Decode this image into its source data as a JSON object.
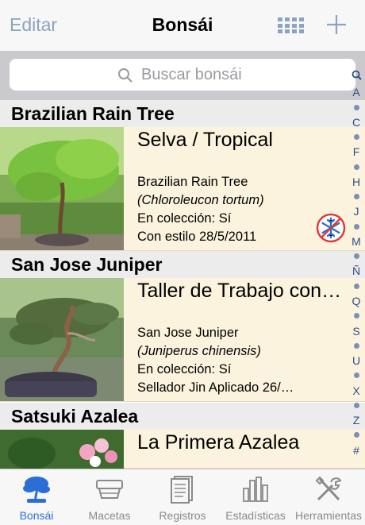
{
  "nav": {
    "edit": "Editar",
    "title": "Bonsái"
  },
  "search": {
    "placeholder": "Buscar bonsái"
  },
  "sections": [
    {
      "header": "Brazilian Rain Tree",
      "item": {
        "title": "Selva / Tropical",
        "common_name": "Brazilian Rain Tree",
        "scientific_name": "(Chloroleucon tortum)",
        "collection": "En colección: Sí",
        "status": "Con estilo 28/5/2011",
        "badge_icon": "no-frost-icon"
      }
    },
    {
      "header": "San Jose Juniper",
      "item": {
        "title": "Taller de Trabajo con…",
        "common_name": "San Jose Juniper",
        "scientific_name": "(Juniperus chinensis)",
        "collection": "En colección: Sí",
        "status": "Sellador Jin Aplicado 26/…"
      }
    },
    {
      "header": "Satsuki Azalea",
      "item": {
        "title": "La Primera Azalea"
      }
    }
  ],
  "index": [
    "A",
    "C",
    "F",
    "H",
    "J",
    "M",
    "Ñ",
    "Q",
    "S",
    "U",
    "X",
    "Z",
    "#"
  ],
  "tabs": [
    {
      "label": "Bonsái",
      "icon": "tree-icon",
      "active": true
    },
    {
      "label": "Macetas",
      "icon": "pot-icon"
    },
    {
      "label": "Registros",
      "icon": "document-icon"
    },
    {
      "label": "Estadísticas",
      "icon": "bar-chart-icon"
    },
    {
      "label": "Herramientas",
      "icon": "tools-icon"
    }
  ],
  "colors": {
    "accent": "#2a6fd6",
    "row_background": "#fbf3dd",
    "nav_text_disabled": "#8ea3c0",
    "index_text": "#2e4f86"
  }
}
